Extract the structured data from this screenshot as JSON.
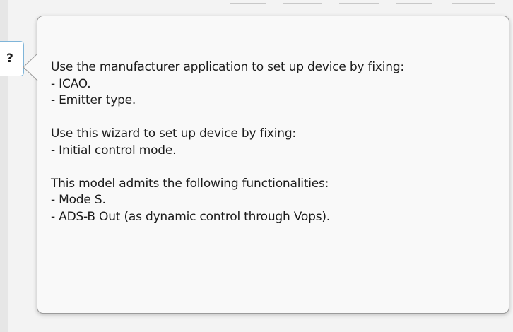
{
  "help_button": {
    "label": "?"
  },
  "tooltip": {
    "sections": [
      {
        "heading": "Use the manufacturer application to set up device by fixing:",
        "items": [
          "- ICAO.",
          "- Emitter type."
        ]
      },
      {
        "heading": "Use this wizard to set up device by fixing:",
        "items": [
          "- Initial control mode."
        ]
      },
      {
        "heading": "This model admits the following functionalities:",
        "items": [
          "- Mode S.",
          "- ADS-B Out (as dynamic control through Vops)."
        ]
      }
    ]
  },
  "colors": {
    "tooltip_background": "#f9f9f9",
    "tooltip_border": "#9a9a9a",
    "help_button_border": "#7fb5d9",
    "text": "#1b1b1b"
  }
}
